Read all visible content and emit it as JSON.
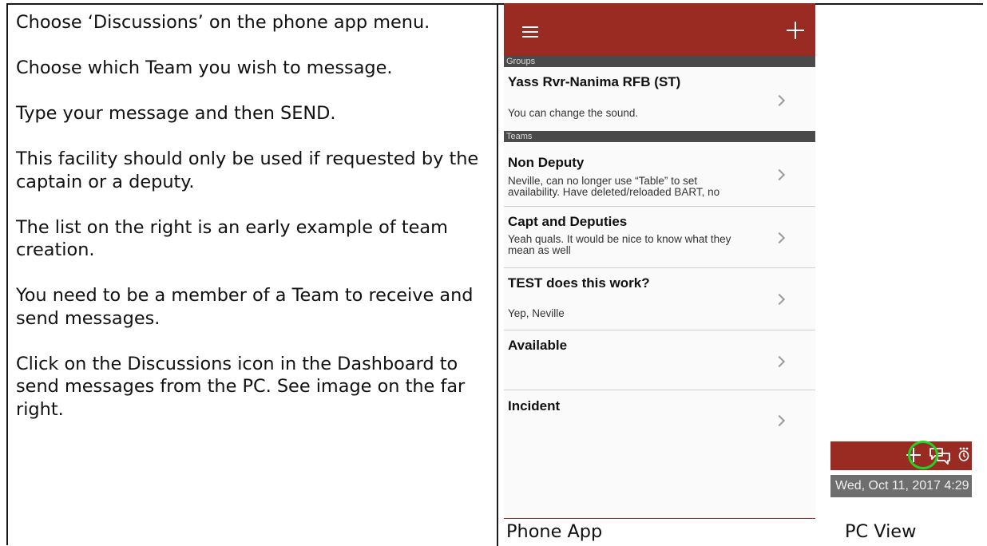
{
  "instructions": [
    "Choose ‘Discussions’ on the phone app menu.",
    "Choose which Team you wish to message.",
    "Type your message and then SEND.",
    "This facility should only be used if requested by the captain or a deputy.",
    "The list on the right is an early example of team creation.",
    "You need to be a member of a Team to receive and send messages.",
    "Click on the Discussions icon in the Dashboard to send messages from the PC. See image on the far right."
  ],
  "phone": {
    "groups_header": "Groups",
    "teams_header": "Teams",
    "groups": [
      {
        "title": "Yass Rvr-Nanima RFB (ST)",
        "subtitle": "You can change the sound."
      }
    ],
    "teams": [
      {
        "title": "Non Deputy",
        "subtitle": "Neville, can no longer use “Table” to set availability.  Have deleted/reloaded BART, no"
      },
      {
        "title": "Capt and Deputies",
        "subtitle": "Yeah quals. It would be nice to know what they mean as well"
      },
      {
        "title": "TEST does this work?",
        "subtitle": "Yep, Neville"
      },
      {
        "title": "Available",
        "subtitle": ""
      },
      {
        "title": "Incident",
        "subtitle": ""
      }
    ],
    "caption": "Phone App"
  },
  "pc": {
    "date_text": "Wed, Oct 11, 2017 4:29",
    "caption": "PC View"
  },
  "colors": {
    "app_bar": "#9a2b23",
    "section_header": "#4a4a4a",
    "highlight": "#22d422"
  }
}
